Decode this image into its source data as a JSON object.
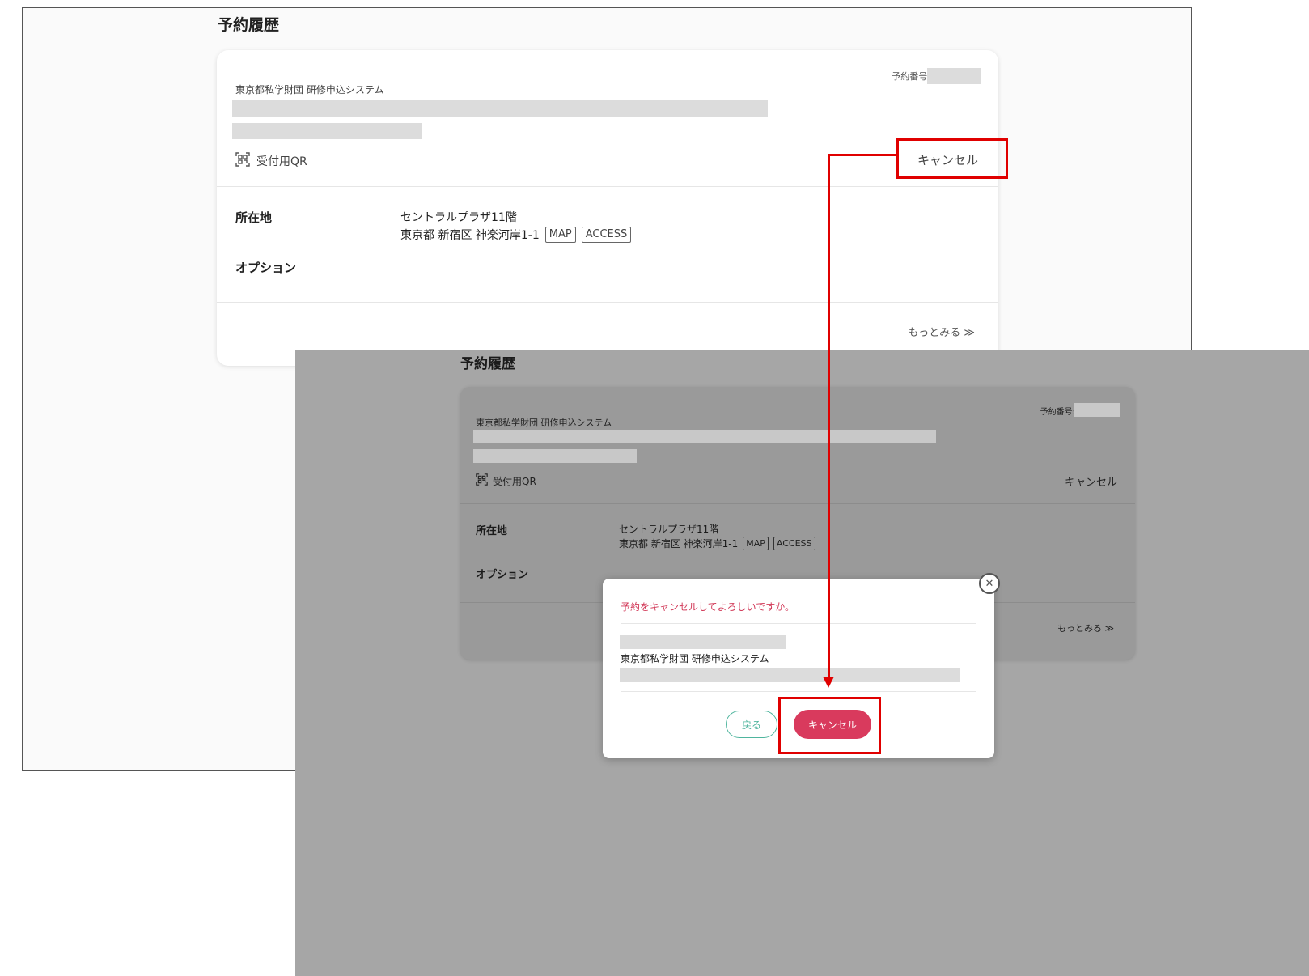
{
  "screen1": {
    "page_title": "予約履歴",
    "reservation_no_label": "予約番号:",
    "organization": "東京都私学財団 研修申込システム",
    "qr_label": "受付用QR",
    "cancel_link": "キャンセル",
    "location_label": "所在地",
    "location_line1": "セントラルプラザ11階",
    "location_line2": "東京都 新宿区 神楽河岸1-1",
    "map_tag": "MAP",
    "access_tag": "ACCESS",
    "option_label": "オプション",
    "more_link": "もっとみる ≫"
  },
  "screen2": {
    "page_title": "予約履歴",
    "reservation_no_label": "予約番号:",
    "organization": "東京都私学財団 研修申込システム",
    "qr_label": "受付用QR",
    "cancel_link": "キャンセル",
    "location_label": "所在地",
    "location_line1": "セントラルプラザ11階",
    "location_line2": "東京都 新宿区 神楽河岸1-1",
    "map_tag": "MAP",
    "access_tag": "ACCESS",
    "option_label": "オプション",
    "more_link": "もっとみる ≫"
  },
  "dialog": {
    "question": "予約をキャンセルしてよろしいですか。",
    "organization": "東京都私学財団 研修申込システム",
    "back_button": "戻る",
    "cancel_button": "キャンセル",
    "close_icon": "close-circle-icon"
  },
  "colors": {
    "highlight": "#e00000",
    "accent_red": "#d93a5d",
    "accent_green": "#4fb59e",
    "overlay": "#a6a6a6"
  }
}
